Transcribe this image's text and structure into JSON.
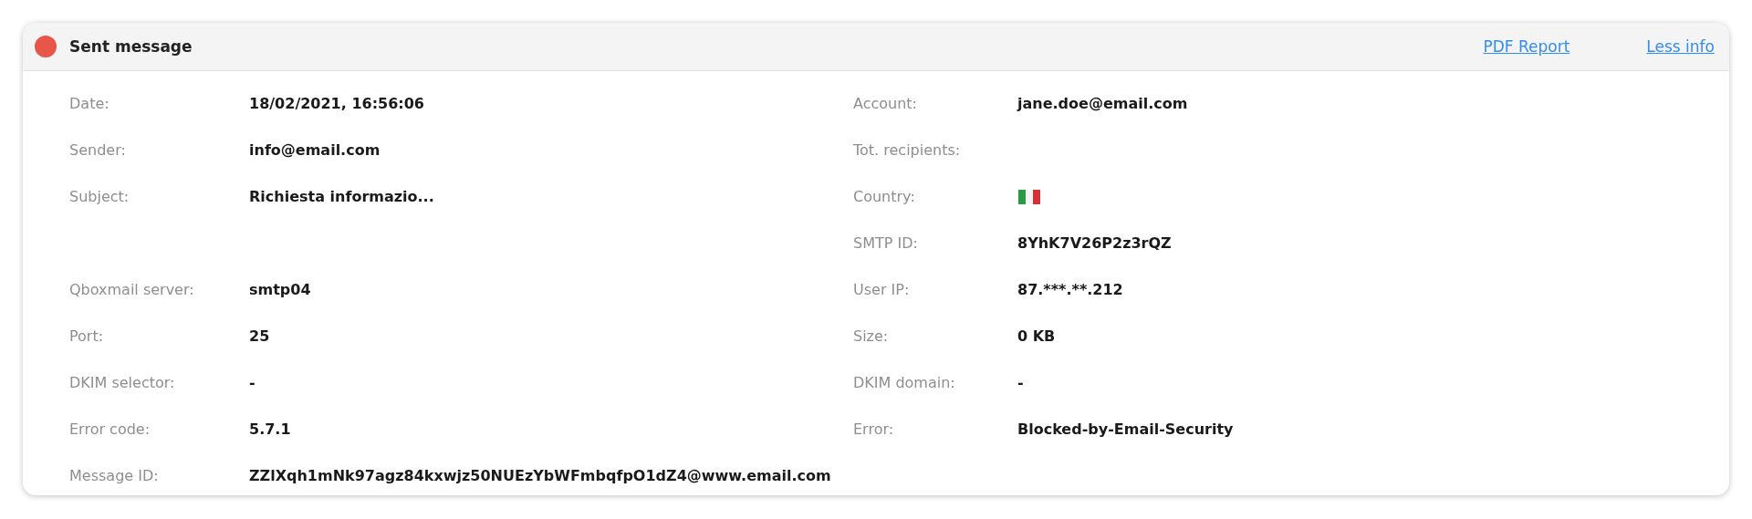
{
  "header": {
    "title": "Sent message",
    "links": [
      "PDF Report",
      "Less info"
    ]
  },
  "rows": [
    {
      "left": {
        "label": "Date:",
        "value": "18/02/2021, 16:56:06"
      },
      "right": {
        "label": "Account:",
        "kind": "text",
        "value": "jane.doe@email.com"
      }
    },
    {
      "left": {
        "label": "Sender:",
        "value": "info@email.com"
      },
      "right": {
        "label": "Tot. recipients:",
        "kind": "text"
      }
    },
    {
      "left": {
        "label": "Subject:",
        "value": "Richiesta informazio..."
      },
      "right": {
        "label": "Country:",
        "kind": "flag"
      }
    },
    {
      "right": {
        "label": "SMTP ID:",
        "kind": "text",
        "value": "8YhK7V26P2z3rQZ"
      }
    },
    {
      "left": {
        "label": "Qboxmail server:",
        "value": "smtp04"
      },
      "right": {
        "label": "User IP:",
        "kind": "text",
        "value": "87.***.**.212"
      }
    },
    {
      "left": {
        "label": "Port:",
        "value": "25"
      },
      "right": {
        "label": "Size:",
        "kind": "text",
        "value": "0 KB"
      }
    },
    {
      "left": {
        "label": "DKIM selector:",
        "value": "-"
      },
      "right": {
        "label": "DKIM domain:",
        "kind": "text",
        "value": "-"
      }
    },
    {
      "left": {
        "label": "Error code:",
        "value": "5.7.1"
      },
      "right": {
        "label": "Error:",
        "kind": "text",
        "value": "Blocked-by-Email-Security"
      }
    },
    {
      "left": {
        "label": "Message ID:",
        "value": "ZZlXqh1mNk97agz84kxwjz50NUEzYbWFmbqfpO1dZ4@www.email.com"
      }
    }
  ]
}
